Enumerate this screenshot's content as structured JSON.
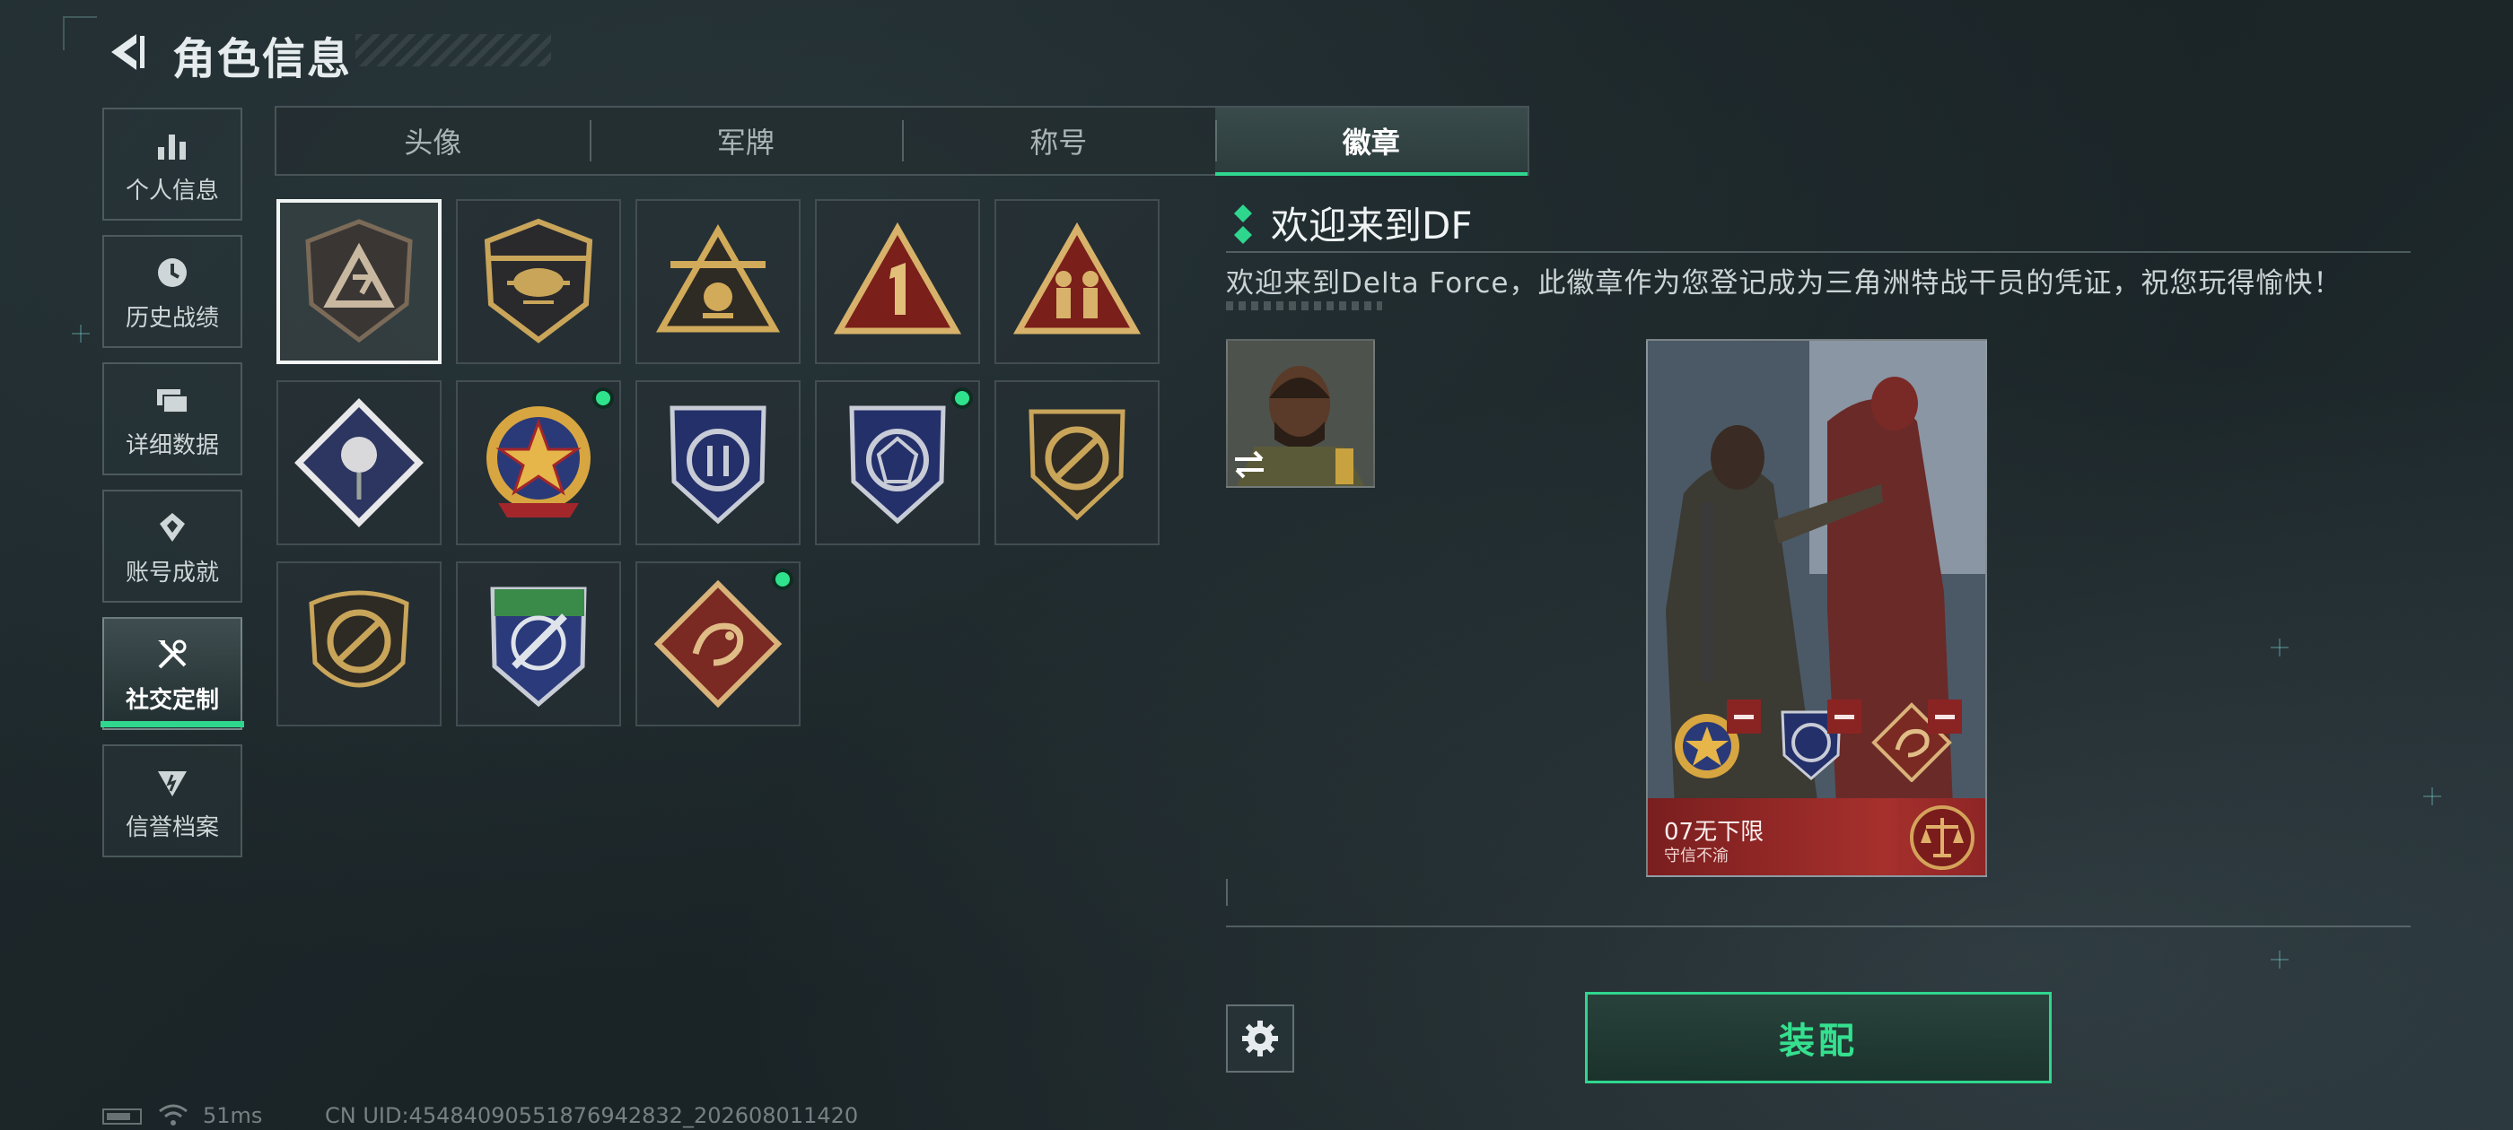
{
  "header": {
    "title": "角色信息"
  },
  "sidebar": {
    "items": [
      {
        "label": "个人信息",
        "icon": "bar-chart-icon"
      },
      {
        "label": "历史战绩",
        "icon": "clock-icon"
      },
      {
        "label": "详细数据",
        "icon": "folders-icon"
      },
      {
        "label": "账号成就",
        "icon": "achievement-icon"
      },
      {
        "label": "社交定制",
        "icon": "tools-icon",
        "active": true
      },
      {
        "label": "信誉档案",
        "icon": "reputation-icon"
      }
    ]
  },
  "tabs": [
    {
      "label": "头像"
    },
    {
      "label": "军牌"
    },
    {
      "label": "称号"
    },
    {
      "label": "徽章",
      "active": true
    }
  ],
  "badges": [
    {
      "name": "delta-triangle-badge",
      "selected": true,
      "new": false
    },
    {
      "name": "helicopter-badge",
      "new": false
    },
    {
      "name": "s9-triangle-badge",
      "new": false
    },
    {
      "name": "number-one-badge",
      "new": false
    },
    {
      "name": "soldiers-triangle-badge",
      "new": false
    },
    {
      "name": "rose-diamond-badge",
      "new": false
    },
    {
      "name": "star-ring-badge",
      "new": true
    },
    {
      "name": "blue-shield-arrow-badge",
      "new": false
    },
    {
      "name": "blue-shield-gem-badge",
      "new": true
    },
    {
      "name": "no-rifle-shield-badge",
      "new": false
    },
    {
      "name": "no-rifle-round-badge",
      "new": false
    },
    {
      "name": "blue-crosshair-knife-badge",
      "new": false
    },
    {
      "name": "dragon-diamond-badge",
      "new": true
    }
  ],
  "detail": {
    "badge_name": "欢迎来到DF",
    "description": "欢迎来到Delta Force，此徽章作为您登记成为三角洲特战干员的凭证，祝您玩得愉快！"
  },
  "card": {
    "player_name": "07无下限",
    "motto": "守信不渝"
  },
  "actions": {
    "equip_label": "装配"
  },
  "status": {
    "ping": "51ms",
    "uid": "CN UID:454840905518769428​32_202608011420"
  },
  "colors": {
    "accent": "#2fd68e",
    "new_dot": "#2fe38d",
    "card_footer": "#a6302c"
  }
}
